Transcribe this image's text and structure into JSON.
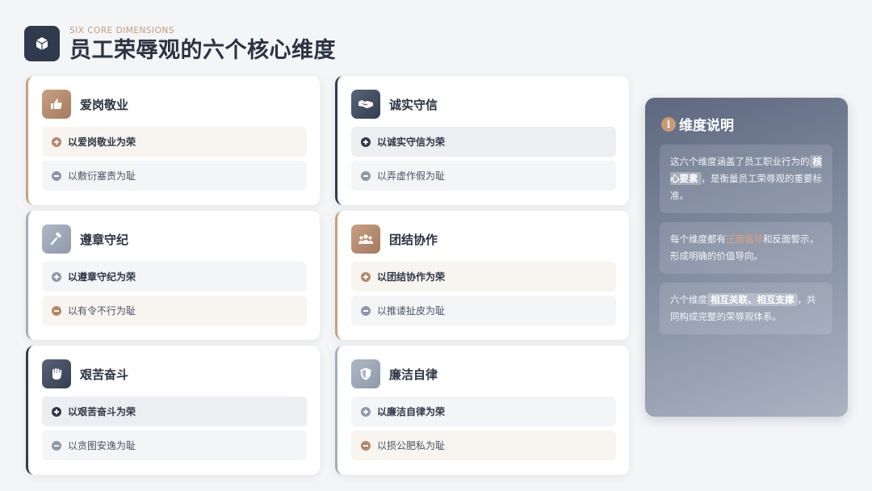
{
  "header": {
    "eyebrow": "SIX CORE DIMENSIONS",
    "title": "员工荣辱观的六个核心维度",
    "icon": "cube-icon"
  },
  "cards": [
    {
      "title": "爱岗敬业",
      "icon": "thumbs-up-icon",
      "honor": "以爱岗敬业为荣",
      "shame": "以敷衍塞责为耻"
    },
    {
      "title": "诚实守信",
      "icon": "handshake-icon",
      "honor": "以诚实守信为荣",
      "shame": "以弄虚作假为耻"
    },
    {
      "title": "遵章守纪",
      "icon": "gavel-icon",
      "honor": "以遵章守纪为荣",
      "shame": "以有令不行为耻"
    },
    {
      "title": "团结协作",
      "icon": "people-icon",
      "honor": "以团结协作为荣",
      "shame": "以推诿扯皮为耻"
    },
    {
      "title": "艰苦奋斗",
      "icon": "fist-icon",
      "honor": "以艰苦奋斗为荣",
      "shame": "以贪图安逸为耻"
    },
    {
      "title": "廉洁自律",
      "icon": "shield-icon",
      "honor": "以廉洁自律为荣",
      "shame": "以损公肥私为耻"
    }
  ],
  "panel": {
    "title": "维度说明",
    "icon": "info-icon",
    "notes": [
      {
        "pre": "这六个维度涵盖了员工职业行为的",
        "hl": "核心要素",
        "post": "，是衡量员工荣辱观的重要标准。"
      },
      {
        "pre": "每个维度都有",
        "hl": "正面倡导",
        "post": "和反面警示，形成明确的价值导向。"
      },
      {
        "pre": "六个维度",
        "hl": "相互关联、相互支撑",
        "post": "，共同构成完整的荣辱观体系。"
      }
    ]
  },
  "colors": {
    "navy": "#2f3848",
    "copper": "#b48769",
    "steel": "#8e98a9"
  }
}
